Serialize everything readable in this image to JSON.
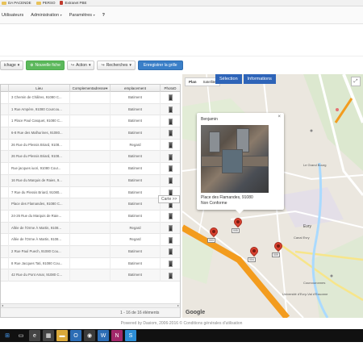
{
  "bookmarks": [
    {
      "label": "DA PACENDE",
      "icon": "folder-icon"
    },
    {
      "label": "PERSO",
      "icon": "folder-icon"
    },
    {
      "label": "Extranet PBE",
      "icon": "page-icon"
    }
  ],
  "nav": {
    "items": [
      "Utilisateurs",
      "Administration",
      "Paramètres"
    ],
    "help": "?"
  },
  "toolbar": {
    "affichage": "ichage",
    "nouvelle_fiche": "Nouvelle fiche",
    "action": "Action",
    "recherches": "Recherches",
    "enregistrer": "Enregistrer la grille"
  },
  "grid": {
    "headers": [
      "",
      "Lieu",
      "Complementadresse",
      "emplacement",
      "PhotoD"
    ],
    "rows": [
      {
        "lieu": "3 Chemin de Châlres, 91080 C...",
        "emplacement": "Batiment"
      },
      {
        "lieu": "1 Rue Ampère, 91080 Courcou...",
        "emplacement": "Batiment"
      },
      {
        "lieu": "1 Place Paul Casquet, 91080 C...",
        "emplacement": "Batiment"
      },
      {
        "lieu": "6-8 Rue des Malhurines, 91080...",
        "emplacement": "Batiment"
      },
      {
        "lieu": "26 Rue du Plessis Briard, 9108...",
        "emplacement": "Regard"
      },
      {
        "lieu": "26 Rue du Plessis Briard, 9108...",
        "emplacement": "Batiment"
      },
      {
        "lieu": "Rue jacques iuori, 91080 Cour...",
        "emplacement": "Batiment"
      },
      {
        "lieu": "16 Rue du Marquis de Raies, 9...",
        "emplacement": "Batiment"
      },
      {
        "lieu": "7 Rue du Plessis Briard, 91080...",
        "emplacement": "Batiment"
      },
      {
        "lieu": "Place des Flamandes, 91080 C...",
        "emplacement": "Batiment"
      },
      {
        "lieu": "24-26 Rue du Marquis de Raie...",
        "emplacement": "Batiment"
      },
      {
        "lieu": "Allée de l'Orme À Martin, 9108...",
        "emplacement": "Regard"
      },
      {
        "lieu": "Allée de l'Orme À Martin, 9108...",
        "emplacement": "Regard"
      },
      {
        "lieu": "2 Rue Paul Puech, 91080 Cou...",
        "emplacement": "Batiment"
      },
      {
        "lieu": "8 Rue Jacques Tati, 91080 Cou...",
        "emplacement": "Batiment"
      },
      {
        "lieu": "42 Rue du Pont Amar, 91080 C...",
        "emplacement": "Batiment"
      }
    ],
    "pager": "1 - 16 de 16 éléments"
  },
  "carte_button": "Carte >>",
  "map": {
    "type_buttons": [
      "Plan",
      "Satellite"
    ],
    "tabs": [
      "Sélection",
      "Informations"
    ],
    "infowindow": {
      "title": "Benjamin",
      "address": "Place des Flamandes, 91080",
      "status": "Non Conforme"
    },
    "markers": [
      {
        "label": "005"
      },
      {
        "label": "003"
      },
      {
        "label": "004"
      },
      {
        "label": "009"
      }
    ],
    "places": [
      "Evry",
      "Courcouronnes",
      "Université d'Evry-Val d'Essonne",
      "Canal Evry",
      "Le Grand Bourg"
    ],
    "google": "Google",
    "road_color": "#f39c1e",
    "water_color": "#aadaff"
  },
  "footer": "Powered by Dasiom, 2006-2016 ©  Conditions générales d'utilisation",
  "colors": {
    "green_button": "#5cb85c",
    "blue_button": "#3a7fc8",
    "map_tab": "#2e64b8",
    "marker": "#d9412f"
  }
}
